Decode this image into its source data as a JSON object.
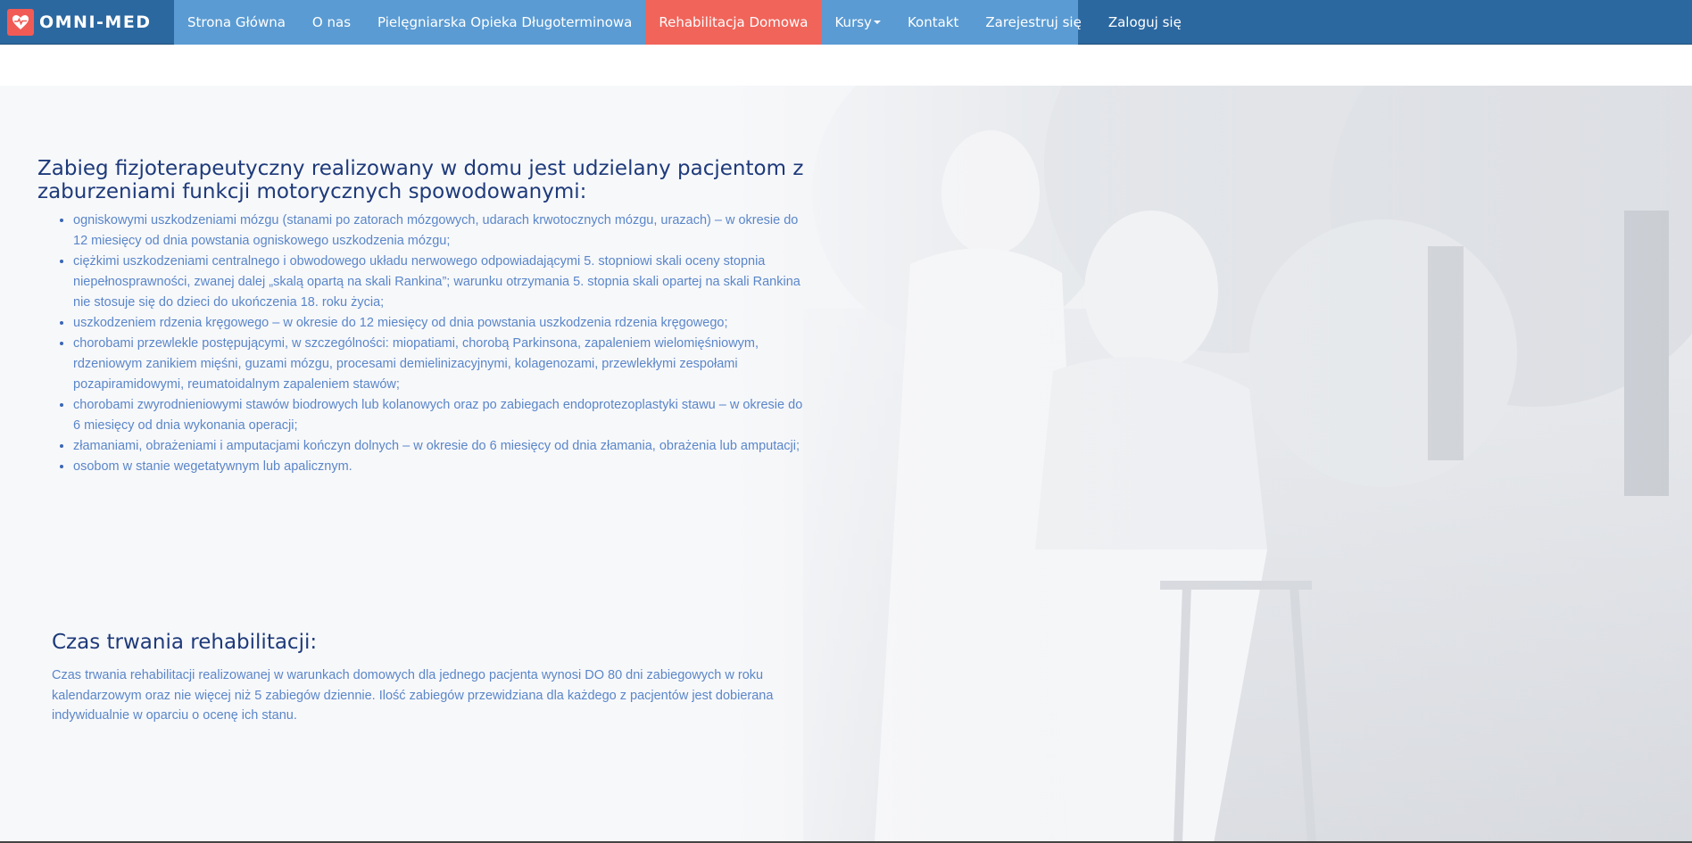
{
  "brand": {
    "name": "OMNI-MED",
    "logo_icon": "heart-pulse-icon",
    "colors": {
      "nav": "#2c68a0",
      "nav_strip": "#5a9bd3",
      "active": "#f1645a",
      "logo_bg": "#f15b55"
    }
  },
  "nav": {
    "items": [
      {
        "label": "Strona Główna"
      },
      {
        "label": "O nas"
      },
      {
        "label": "Pielęgniarska Opieka Długoterminowa"
      },
      {
        "label": "Rehabilitacja Domowa"
      },
      {
        "label": "Kursy"
      },
      {
        "label": "Kontakt"
      },
      {
        "label": "Zarejestruj się"
      },
      {
        "label": "Zaloguj się"
      }
    ]
  },
  "main": {
    "heading": "Zabieg fizjoterapeutyczny realizowany w domu jest udzielany pacjentom z zaburzeniami funkcji motorycznych spowodowanymi:",
    "items": [
      "ogniskowymi uszkodzeniami mózgu (stanami po zatorach mózgowych, udarach krwotocznych mózgu, urazach) – w okresie do 12 miesięcy od dnia powstania ogniskowego uszkodzenia mózgu;",
      "ciężkimi uszkodzeniami centralnego i obwodowego układu nerwowego odpowiadającymi 5. stopniowi skali oceny stopnia niepełnosprawności, zwanej dalej „skalą opartą na skali Rankina”; warunku otrzymania 5. stopnia skali opartej na skali Rankina nie stosuje się do dzieci do ukończenia 18. roku życia;",
      "uszkodzeniem rdzenia kręgowego – w okresie do 12 miesięcy od dnia powstania uszkodzenia rdzenia kręgowego;",
      "chorobami przewlekle postępującymi, w szczególności: miopatiami, chorobą Parkinsona, zapaleniem wielomięśniowym, rdzeniowym zanikiem mięśni, guzami mózgu, procesami demielinizacyjnymi, kolagenozami, przewlekłymi zespołami pozapiramidowymi, reumatoidalnym zapaleniem stawów;",
      "chorobami zwyrodnieniowymi stawów biodrowych lub kolanowych oraz po zabiegach endoprotezoplastyki stawu – w okresie do 6 miesięcy od dnia wykonania operacji;",
      "złamaniami, obrażeniami i amputacjami kończyn dolnych – w okresie do 6 miesięcy od dnia złamania, obrażenia lub amputacji;",
      "osobom w stanie wegetatywnym lub apalicznym."
    ]
  },
  "duration": {
    "heading": "Czas trwania rehabilitacji:",
    "text": "Czas trwania rehabilitacji realizowanej w warunkach domowych dla jednego pacjenta wynosi DO 80 dni zabiegowych w roku kalendarzowym oraz nie więcej niż 5 zabiegów dziennie. Ilość zabiegów przewidziana dla każdego z pacjentów jest dobierana indywidualnie w oparciu o ocenę ich stanu."
  }
}
